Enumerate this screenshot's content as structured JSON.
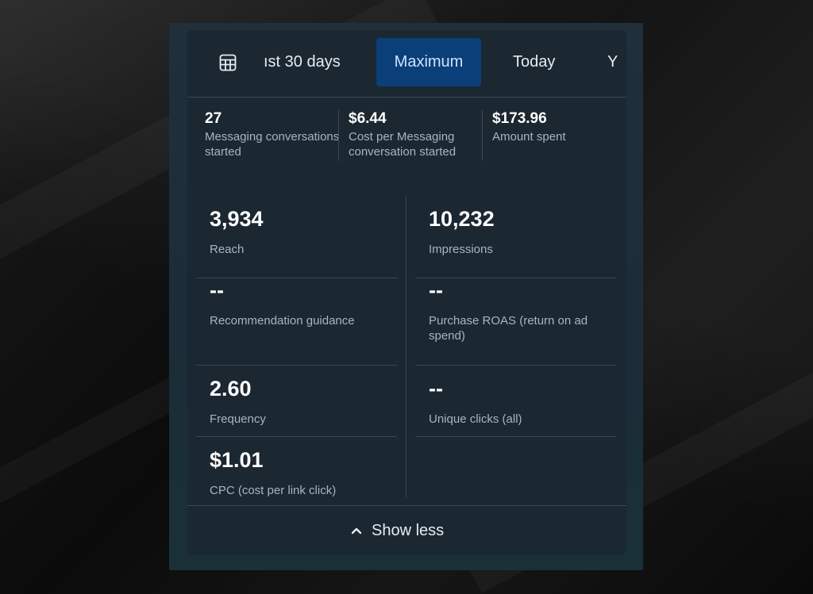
{
  "tabs": {
    "items": [
      {
        "label": "ıst 30 days",
        "active": false
      },
      {
        "label": "Maximum",
        "active": true
      },
      {
        "label": "Today",
        "active": false
      },
      {
        "label": "Y",
        "active": false
      }
    ],
    "calendar_icon": "calendar-table-icon"
  },
  "summary": [
    {
      "value": "27",
      "label": "Messaging conversations started"
    },
    {
      "value": "$6.44",
      "label": "Cost per Messaging conversation started"
    },
    {
      "value": "$173.96",
      "label": "Amount spent"
    }
  ],
  "metrics": {
    "left": [
      {
        "value": "3,934",
        "label": "Reach"
      },
      {
        "value": "--",
        "label": "Recommendation guidance"
      },
      {
        "value": "2.60",
        "label": "Frequency"
      },
      {
        "value": "$1.01",
        "label": "CPC (cost per link click)"
      }
    ],
    "right": [
      {
        "value": "10,232",
        "label": "Impressions"
      },
      {
        "value": "--",
        "label": "Purchase ROAS (return on ad spend)"
      },
      {
        "value": "--",
        "label": "Unique clicks (all)"
      }
    ]
  },
  "footer": {
    "show_less_label": "Show less",
    "icon": "chevron-up-icon"
  },
  "colors": {
    "active_tab_bg": "#0a3f79",
    "card_bg": "#1b2731",
    "label_text": "#a9b5be"
  }
}
